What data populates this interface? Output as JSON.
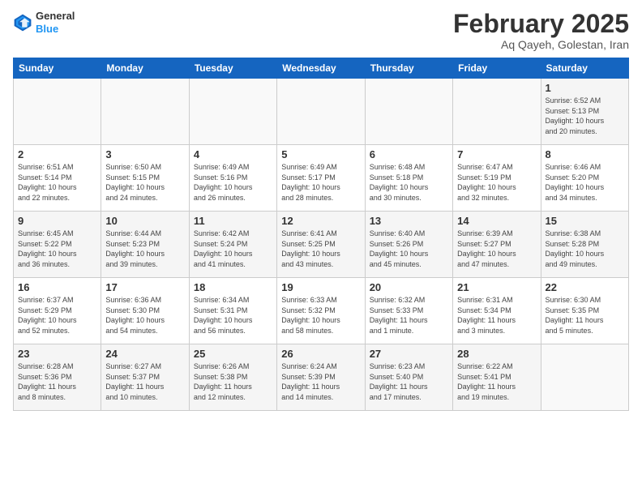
{
  "logo": {
    "line1": "General",
    "line2": "Blue"
  },
  "title": "February 2025",
  "subtitle": "Aq Qayeh, Golestan, Iran",
  "days_header": [
    "Sunday",
    "Monday",
    "Tuesday",
    "Wednesday",
    "Thursday",
    "Friday",
    "Saturday"
  ],
  "weeks": [
    [
      {
        "day": "",
        "info": ""
      },
      {
        "day": "",
        "info": ""
      },
      {
        "day": "",
        "info": ""
      },
      {
        "day": "",
        "info": ""
      },
      {
        "day": "",
        "info": ""
      },
      {
        "day": "",
        "info": ""
      },
      {
        "day": "1",
        "info": "Sunrise: 6:52 AM\nSunset: 5:13 PM\nDaylight: 10 hours\nand 20 minutes."
      }
    ],
    [
      {
        "day": "2",
        "info": "Sunrise: 6:51 AM\nSunset: 5:14 PM\nDaylight: 10 hours\nand 22 minutes."
      },
      {
        "day": "3",
        "info": "Sunrise: 6:50 AM\nSunset: 5:15 PM\nDaylight: 10 hours\nand 24 minutes."
      },
      {
        "day": "4",
        "info": "Sunrise: 6:49 AM\nSunset: 5:16 PM\nDaylight: 10 hours\nand 26 minutes."
      },
      {
        "day": "5",
        "info": "Sunrise: 6:49 AM\nSunset: 5:17 PM\nDaylight: 10 hours\nand 28 minutes."
      },
      {
        "day": "6",
        "info": "Sunrise: 6:48 AM\nSunset: 5:18 PM\nDaylight: 10 hours\nand 30 minutes."
      },
      {
        "day": "7",
        "info": "Sunrise: 6:47 AM\nSunset: 5:19 PM\nDaylight: 10 hours\nand 32 minutes."
      },
      {
        "day": "8",
        "info": "Sunrise: 6:46 AM\nSunset: 5:20 PM\nDaylight: 10 hours\nand 34 minutes."
      }
    ],
    [
      {
        "day": "9",
        "info": "Sunrise: 6:45 AM\nSunset: 5:22 PM\nDaylight: 10 hours\nand 36 minutes."
      },
      {
        "day": "10",
        "info": "Sunrise: 6:44 AM\nSunset: 5:23 PM\nDaylight: 10 hours\nand 39 minutes."
      },
      {
        "day": "11",
        "info": "Sunrise: 6:42 AM\nSunset: 5:24 PM\nDaylight: 10 hours\nand 41 minutes."
      },
      {
        "day": "12",
        "info": "Sunrise: 6:41 AM\nSunset: 5:25 PM\nDaylight: 10 hours\nand 43 minutes."
      },
      {
        "day": "13",
        "info": "Sunrise: 6:40 AM\nSunset: 5:26 PM\nDaylight: 10 hours\nand 45 minutes."
      },
      {
        "day": "14",
        "info": "Sunrise: 6:39 AM\nSunset: 5:27 PM\nDaylight: 10 hours\nand 47 minutes."
      },
      {
        "day": "15",
        "info": "Sunrise: 6:38 AM\nSunset: 5:28 PM\nDaylight: 10 hours\nand 49 minutes."
      }
    ],
    [
      {
        "day": "16",
        "info": "Sunrise: 6:37 AM\nSunset: 5:29 PM\nDaylight: 10 hours\nand 52 minutes."
      },
      {
        "day": "17",
        "info": "Sunrise: 6:36 AM\nSunset: 5:30 PM\nDaylight: 10 hours\nand 54 minutes."
      },
      {
        "day": "18",
        "info": "Sunrise: 6:34 AM\nSunset: 5:31 PM\nDaylight: 10 hours\nand 56 minutes."
      },
      {
        "day": "19",
        "info": "Sunrise: 6:33 AM\nSunset: 5:32 PM\nDaylight: 10 hours\nand 58 minutes."
      },
      {
        "day": "20",
        "info": "Sunrise: 6:32 AM\nSunset: 5:33 PM\nDaylight: 11 hours\nand 1 minute."
      },
      {
        "day": "21",
        "info": "Sunrise: 6:31 AM\nSunset: 5:34 PM\nDaylight: 11 hours\nand 3 minutes."
      },
      {
        "day": "22",
        "info": "Sunrise: 6:30 AM\nSunset: 5:35 PM\nDaylight: 11 hours\nand 5 minutes."
      }
    ],
    [
      {
        "day": "23",
        "info": "Sunrise: 6:28 AM\nSunset: 5:36 PM\nDaylight: 11 hours\nand 8 minutes."
      },
      {
        "day": "24",
        "info": "Sunrise: 6:27 AM\nSunset: 5:37 PM\nDaylight: 11 hours\nand 10 minutes."
      },
      {
        "day": "25",
        "info": "Sunrise: 6:26 AM\nSunset: 5:38 PM\nDaylight: 11 hours\nand 12 minutes."
      },
      {
        "day": "26",
        "info": "Sunrise: 6:24 AM\nSunset: 5:39 PM\nDaylight: 11 hours\nand 14 minutes."
      },
      {
        "day": "27",
        "info": "Sunrise: 6:23 AM\nSunset: 5:40 PM\nDaylight: 11 hours\nand 17 minutes."
      },
      {
        "day": "28",
        "info": "Sunrise: 6:22 AM\nSunset: 5:41 PM\nDaylight: 11 hours\nand 19 minutes."
      },
      {
        "day": "",
        "info": ""
      }
    ]
  ]
}
